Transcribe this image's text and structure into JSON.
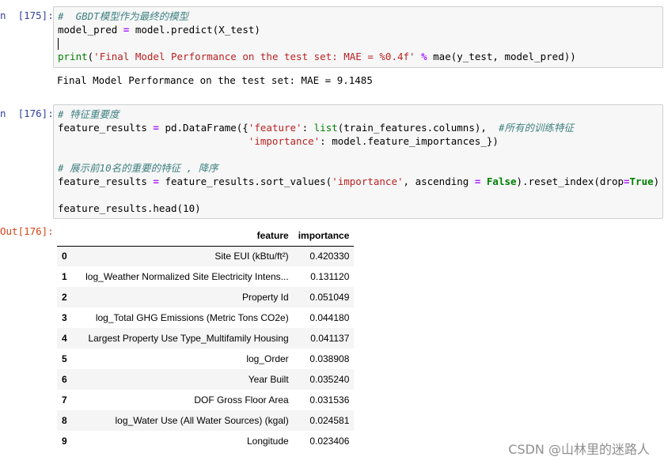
{
  "cells": [
    {
      "prompt": "n  [175]:",
      "lines": [
        [
          {
            "t": "#  GBDT模型作为最终的模型",
            "c": "cm"
          }
        ],
        [
          {
            "t": "model_pred "
          },
          {
            "t": "=",
            "c": "op"
          },
          {
            "t": " model.predict(X_test)"
          }
        ],
        [],
        [
          {
            "t": "print",
            "c": "bi"
          },
          {
            "t": "("
          },
          {
            "t": "'Final Model Performance on the test set: MAE = %0.4f'",
            "c": "st"
          },
          {
            "t": " "
          },
          {
            "t": "%",
            "c": "op"
          },
          {
            "t": " mae(y_test, model_pred))"
          }
        ]
      ],
      "output": "Final Model Performance on the test set: MAE = 9.1485"
    },
    {
      "prompt": "n  [176]:",
      "lines": [
        [
          {
            "t": "# 特征重要度",
            "c": "cm"
          }
        ],
        [
          {
            "t": "feature_results "
          },
          {
            "t": "=",
            "c": "op"
          },
          {
            "t": " pd.DataFrame({"
          },
          {
            "t": "'feature'",
            "c": "st"
          },
          {
            "t": ": "
          },
          {
            "t": "list",
            "c": "bi"
          },
          {
            "t": "(train_features.columns),  "
          },
          {
            "t": "#所有的训练特征",
            "c": "cm"
          }
        ],
        [
          {
            "t": "                                "
          },
          {
            "t": "'importance'",
            "c": "st"
          },
          {
            "t": ": model.feature_importances_})"
          }
        ],
        [],
        [
          {
            "t": "# 展示前10名的重要的特征 , 降序",
            "c": "cm"
          }
        ],
        [
          {
            "t": "feature_results "
          },
          {
            "t": "=",
            "c": "op"
          },
          {
            "t": " feature_results.sort_values("
          },
          {
            "t": "'importance'",
            "c": "st"
          },
          {
            "t": ", ascending "
          },
          {
            "t": "=",
            "c": "op"
          },
          {
            "t": " "
          },
          {
            "t": "False",
            "c": "kw"
          },
          {
            "t": ").reset_index(drop"
          },
          {
            "t": "=",
            "c": "op"
          },
          {
            "t": "True",
            "c": "kw"
          },
          {
            "t": ")"
          }
        ],
        [],
        [
          {
            "t": "feature_results.head(10)"
          }
        ]
      ],
      "out_prompt": "Out[176]:"
    }
  ],
  "table": {
    "columns": [
      "feature",
      "importance"
    ],
    "rows": [
      {
        "idx": "0",
        "feature": "Site EUI (kBtu/ft²)",
        "importance": "0.420330"
      },
      {
        "idx": "1",
        "feature": "log_Weather Normalized Site Electricity Intens...",
        "importance": "0.131120"
      },
      {
        "idx": "2",
        "feature": "Property Id",
        "importance": "0.051049"
      },
      {
        "idx": "3",
        "feature": "log_Total GHG Emissions (Metric Tons CO2e)",
        "importance": "0.044180"
      },
      {
        "idx": "4",
        "feature": "Largest Property Use Type_Multifamily Housing",
        "importance": "0.041137"
      },
      {
        "idx": "5",
        "feature": "log_Order",
        "importance": "0.038908"
      },
      {
        "idx": "6",
        "feature": "Year Built",
        "importance": "0.035240"
      },
      {
        "idx": "7",
        "feature": "DOF Gross Floor Area",
        "importance": "0.031536"
      },
      {
        "idx": "8",
        "feature": "log_Water Use (All Water Sources) (kgal)",
        "importance": "0.024581"
      },
      {
        "idx": "9",
        "feature": "Longitude",
        "importance": "0.023406"
      }
    ]
  },
  "watermark": "CSDN @山林里的迷路人"
}
